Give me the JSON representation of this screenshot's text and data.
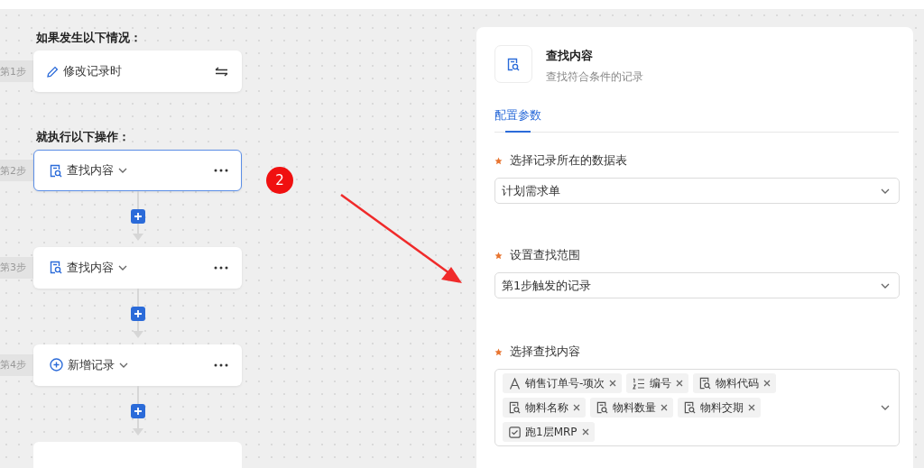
{
  "trigger": {
    "heading": "如果发生以下情况：",
    "step_label": "第1步",
    "label": "修改记录时"
  },
  "actions": {
    "heading": "就执行以下操作：",
    "steps": [
      {
        "step_label": "第2步",
        "label": "查找内容",
        "kind": "find",
        "selected": true
      },
      {
        "step_label": "第3步",
        "label": "查找内容",
        "kind": "find",
        "selected": false
      },
      {
        "step_label": "第4步",
        "label": "新增记录",
        "kind": "add",
        "selected": false
      }
    ]
  },
  "badge": "2",
  "panel": {
    "title": "查找内容",
    "subtitle": "查找符合条件的记录",
    "tabs": [
      {
        "label": "配置参数",
        "selected": true
      }
    ],
    "fields": [
      {
        "kind": "select",
        "label": "选择记录所在的数据表",
        "required": true,
        "value": "计划需求单"
      },
      {
        "kind": "select",
        "label": "设置查找范围",
        "required": true,
        "value": "第1步触发的记录"
      },
      {
        "kind": "tags",
        "label": "选择查找内容",
        "required": true,
        "tags": [
          {
            "kind": "text",
            "label": "销售订单号-项次"
          },
          {
            "kind": "number",
            "label": "编号"
          },
          {
            "kind": "lookup",
            "label": "物料代码"
          },
          {
            "kind": "lookup",
            "label": "物料名称"
          },
          {
            "kind": "lookup",
            "label": "物料数量"
          },
          {
            "kind": "lookup",
            "label": "物料交期"
          },
          {
            "kind": "checkbox",
            "label": "跑1层MRP"
          }
        ]
      }
    ]
  }
}
